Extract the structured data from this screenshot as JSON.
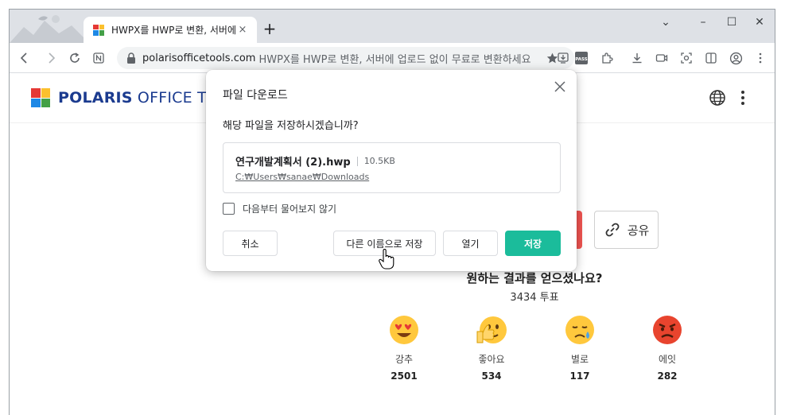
{
  "browser": {
    "tab": {
      "title": "HWPX를 HWP로 변환, 서버에 업",
      "close": "×"
    },
    "new_tab": "+",
    "controls": {
      "chevron": "⌄",
      "minimize": "–",
      "maximize": "☐",
      "close": "✕"
    },
    "url_host": "polarisofficetools.com",
    "url_rest": "HWPX를 HWP로 변환, 서버에 업로드 없이 무료로 변환하세요",
    "extension_label": "PASS"
  },
  "site": {
    "logo_bold": "POLARIS",
    "logo_light": " OFFICE TOOLS"
  },
  "share": {
    "label": "공유"
  },
  "result": {
    "question": "원하는 결과를 얻으셨나요?",
    "votes": "3434 투표",
    "reactions": [
      {
        "label": "강추",
        "count": "2501"
      },
      {
        "label": "좋아요",
        "count": "534"
      },
      {
        "label": "별로",
        "count": "117"
      },
      {
        "label": "에잇",
        "count": "282"
      }
    ]
  },
  "dialog": {
    "title": "파일 다운로드",
    "question": "해당 파일을 저장하시겠습니까?",
    "file_name": "연구개발계획서 (2).hwp",
    "file_size": "10.5KB",
    "file_path": "C:₩Users₩sanae₩Downloads",
    "checkbox_label": "다음부터 물어보지 않기",
    "buttons": {
      "cancel": "취소",
      "save_as": "다른 이름으로 저장",
      "open": "열기",
      "save": "저장"
    }
  },
  "colors": {
    "primary": "#1bbc9b",
    "logo_blue": "#1b3b8f",
    "logo_tiles": [
      "#e53935",
      "#fbc02d",
      "#1e88e5",
      "#43a047"
    ]
  }
}
